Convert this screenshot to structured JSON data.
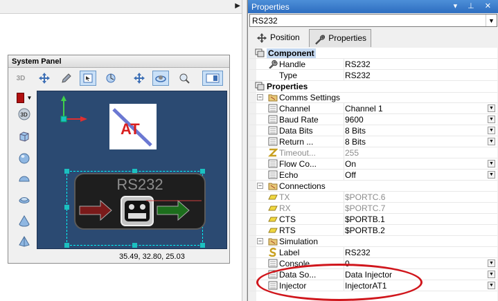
{
  "system_panel": {
    "title": "System Panel",
    "toolbar_3d_label": "3D",
    "side_3d_label": "3D",
    "coords": "35.49, 32.80, 25.03",
    "component_label": "RS232",
    "logo_text": "AT",
    "colors": {
      "canvas": "#2b4a72",
      "selection": "#00ffff",
      "swatch": "#b01010"
    }
  },
  "properties_panel": {
    "title": "Properties",
    "title_buttons": "▾ ⊥ ✕",
    "selected_component": "RS232",
    "tabs": [
      {
        "label": "Position",
        "icon": "move-icon"
      },
      {
        "label": "Properties",
        "icon": "wrench-icon"
      }
    ],
    "rows": [
      {
        "name": "Component",
        "value": "",
        "kind": "root"
      },
      {
        "name": "Handle",
        "value": "RS232"
      },
      {
        "name": "Type",
        "value": "RS232"
      },
      {
        "name": "Properties",
        "value": "",
        "kind": "root"
      },
      {
        "name": "Comms Settings",
        "value": "",
        "kind": "group"
      },
      {
        "name": "Channel",
        "value": "Channel 1",
        "dropdown": true
      },
      {
        "name": "Baud Rate",
        "value": "9600",
        "dropdown": true
      },
      {
        "name": "Data Bits",
        "value": "8 Bits",
        "dropdown": true
      },
      {
        "name": "Return ...",
        "value": "8 Bits",
        "dropdown": true
      },
      {
        "name": "Timeout...",
        "value": "255",
        "disabled": true
      },
      {
        "name": "Flow Co...",
        "value": "On",
        "dropdown": true
      },
      {
        "name": "Echo",
        "value": "Off",
        "dropdown": true
      },
      {
        "name": "Connections",
        "value": "",
        "kind": "group"
      },
      {
        "name": "TX",
        "value": "$PORTC.6",
        "disabled": true
      },
      {
        "name": "RX",
        "value": "$PORTC.7",
        "disabled": true
      },
      {
        "name": "CTS",
        "value": "$PORTB.1"
      },
      {
        "name": "RTS",
        "value": "$PORTB.2"
      },
      {
        "name": "Simulation",
        "value": "",
        "kind": "group"
      },
      {
        "name": "Label",
        "value": "RS232"
      },
      {
        "name": "Console...",
        "value": "0",
        "dropdown": true
      },
      {
        "name": "Data So...",
        "value": "Data Injector",
        "dropdown": true
      },
      {
        "name": "Injector",
        "value": "InjectorAT1",
        "dropdown": true
      }
    ]
  }
}
